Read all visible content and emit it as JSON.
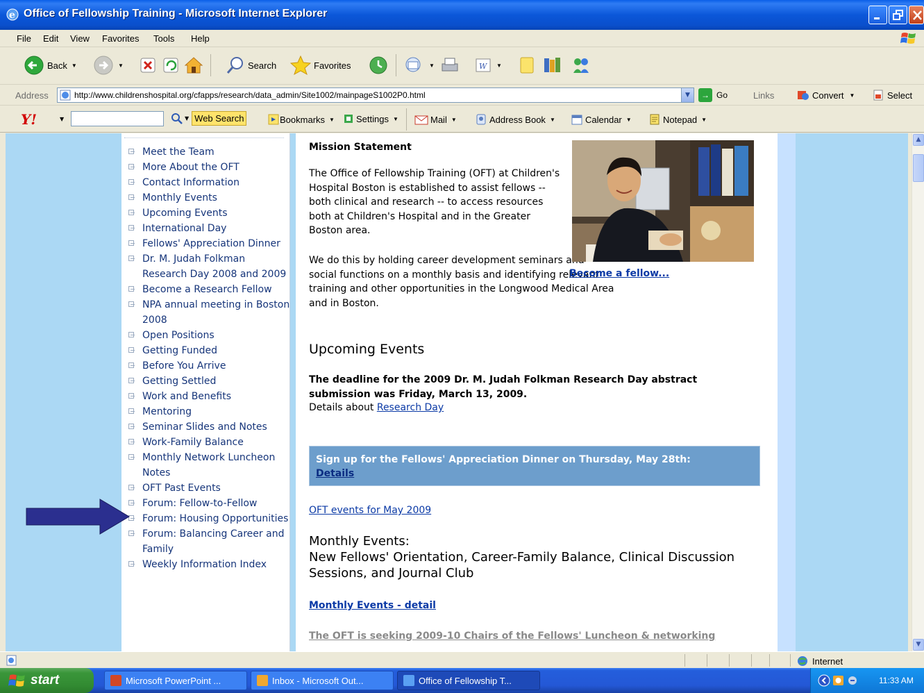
{
  "window": {
    "title": "Office of Fellowship Training - Microsoft Internet Explorer"
  },
  "menu": [
    "File",
    "Edit",
    "View",
    "Favorites",
    "Tools",
    "Help"
  ],
  "toolbar": {
    "back": "Back",
    "search": "Search",
    "favorites": "Favorites"
  },
  "address": {
    "label": "Address",
    "url": "http://www.childrenshospital.org/cfapps/research/data_admin/Site1002/mainpageS1002P0.html",
    "go": "Go",
    "links": "Links",
    "convert": "Convert",
    "select": "Select"
  },
  "yahoo": {
    "logo": "Y!",
    "web_search": "Web Search",
    "bookmarks": "Bookmarks",
    "settings": "Settings",
    "mail": "Mail",
    "address_book": "Address Book",
    "calendar": "Calendar",
    "notepad": "Notepad"
  },
  "nav": [
    "Meet the Team",
    "More About the OFT",
    "Contact Information",
    "Monthly Events",
    "Upcoming Events",
    "International Day",
    "Fellows' Appreciation Dinner",
    "Dr. M. Judah Folkman Research Day 2008 and 2009",
    "Become a Research Fellow",
    "NPA annual meeting in Boston 2008",
    "Open Positions",
    "Getting Funded",
    "Before You Arrive",
    "Getting Settled",
    "Work and Benefits",
    "Mentoring",
    "Seminar Slides and Notes",
    "Work-Family Balance",
    "Monthly Network Luncheon Notes",
    "OFT Past Events",
    "Forum: Fellow-to-Fellow",
    "Forum: Housing Opportunities",
    "Forum: Balancing Career and Family",
    "Weekly Information Index"
  ],
  "main": {
    "mission_heading": "Mission Statement",
    "mission_p1": "The Office of Fellowship Training (OFT) at Children's Hospital Boston is established to assist fellows -- both clinical and research -- to access resources both at Children's Hospital and in the Greater Boston area.",
    "mission_p2": "We do this by holding career development seminars and social functions on a monthly basis and identifying relevant training and other opportunities in the Longwood Medical Area and in Boston.",
    "become_link": "Become a fellow...",
    "upcoming_heading": "Upcoming Events",
    "deadline": "The deadline for the 2009 Dr. M. Judah Folkman Research Day abstract submission was Friday, March 13, 2009.",
    "details_prefix": "Details about",
    "research_day_link": "Research Day",
    "signup_text": "Sign up for the Fellows' Appreciation Dinner on Thursday, May 28th:",
    "signup_details": "Details",
    "oft_may_link": "OFT events for May 2009",
    "monthly_line1": "Monthly Events:",
    "monthly_line2": "New Fellows' Orientation, Career-Family Balance, Clinical Discussion Sessions, and Journal Club",
    "monthly_detail_link": "Monthly Events - detail",
    "seeking_link": "The OFT is seeking 2009-10 Chairs of the Fellows' Luncheon & networking"
  },
  "status": {
    "zone": "Internet"
  },
  "taskbar": {
    "start": "start",
    "items": [
      "Microsoft PowerPoint ...",
      "Inbox - Microsoft Out...",
      "Office of Fellowship T..."
    ],
    "time": "11:33 AM"
  },
  "colors": {
    "page_background": "#ABD8F4",
    "link": "#0B3AA6",
    "nav_text": "#16357A",
    "banner": "#6D9ECC",
    "arrow": "#2B2F8F"
  }
}
